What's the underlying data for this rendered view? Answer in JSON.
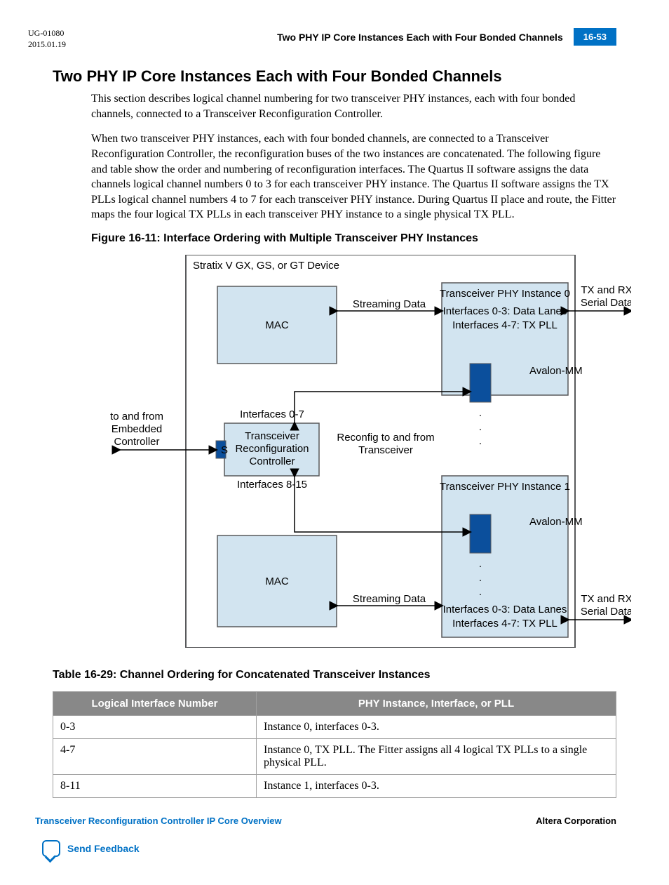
{
  "header": {
    "doc_id": "UG-01080",
    "date": "2015.01.19",
    "running_title": "Two PHY IP Core Instances Each with Four Bonded Channels",
    "page_num": "16-53"
  },
  "section_title": "Two PHY IP Core Instances Each with Four Bonded Channels",
  "para1": "This section describes logical channel numbering for two transceiver PHY instances, each with four bonded channels, connected to a Transceiver Reconfiguration Controller.",
  "para2": "When two transceiver PHY instances, each with four bonded channels, are connected to a Transceiver Reconfiguration Controller, the reconfiguration buses of the two instances are concatenated. The following figure and table show the order and numbering of reconfiguration interfaces. The Quartus II software assigns the data channels logical channel numbers 0 to 3 for each transceiver PHY instance. The Quartus II software assigns the TX PLLs logical channel numbers 4 to 7 for each transceiver PHY instance. During Quartus II place and route, the Fitter maps the four logical TX PLLs in each transceiver PHY instance to a single physical TX PLL.",
  "figure_caption": "Figure 16-11: Interface Ordering with Multiple Transceiver PHY Instances",
  "diagram": {
    "device_label": "Stratix V GX, GS, or GT Device",
    "mac": "MAC",
    "streaming_data": "Streaming Data",
    "phy0_title": "Transceiver PHY Instance 0",
    "phy0_line1": "Interfaces 0-3: Data Lanes",
    "phy0_line2": "Interfaces 4-7: TX PLL",
    "phy1_title": "Transceiver PHY Instance 1",
    "phy1_line1": "Interfaces 0-3: Data Lanes",
    "phy1_line2": "Interfaces 4-7: TX PLL",
    "avalon": "Avalon-MM",
    "reconfig_block_l1": "Transceiver",
    "reconfig_block_l2": "Reconfiguration",
    "reconfig_block_l3": "Controller",
    "reconfig_top": "Interfaces 0-7",
    "reconfig_bot": "Interfaces 8-15",
    "reconfig_label_l1": "Reconfig to and from",
    "reconfig_label_l2": "Transceiver",
    "s_label": "S",
    "embedded_l1": "to and from",
    "embedded_l2": "Embedded",
    "embedded_l3": "Controller",
    "serial_l1": "TX and RX",
    "serial_l2": "Serial Data"
  },
  "table_caption": "Table 16-29: Channel Ordering for Concatenated Transceiver Instances",
  "table": {
    "h1": "Logical Interface Number",
    "h2": "PHY Instance, Interface, or PLL",
    "rows": [
      {
        "c1": "0-3",
        "c2": "Instance 0, interfaces 0-3."
      },
      {
        "c1": "4-7",
        "c2": "Instance 0, TX PLL. The Fitter assigns all 4 logical TX PLLs to a single physical PLL."
      },
      {
        "c1": "8-11",
        "c2": "Instance 1, interfaces 0-3."
      }
    ]
  },
  "footer": {
    "left": "Transceiver Reconfiguration Controller IP Core Overview",
    "right": "Altera Corporation",
    "feedback": "Send Feedback"
  },
  "chart_data": {
    "type": "diagram",
    "description": "Block diagram showing two MAC blocks connected via Streaming Data to two Transceiver PHY Instances (0 and 1) inside a Stratix V device. A Transceiver Reconfiguration Controller connects via Avalon-MM slave (S) to an embedded controller on the left, and via reconfig buses (Interfaces 0-7 and 8-15) to the two PHY instances. Each PHY instance outputs TX and RX Serial Data.",
    "blocks": [
      {
        "name": "MAC",
        "instance": 0
      },
      {
        "name": "MAC",
        "instance": 1
      },
      {
        "name": "Transceiver Reconfiguration Controller",
        "slave_port": "S",
        "interfaces": [
          "0-7",
          "8-15"
        ]
      },
      {
        "name": "Transceiver PHY Instance 0",
        "data_lanes": "Interfaces 0-3",
        "tx_pll": "Interfaces 4-7"
      },
      {
        "name": "Transceiver PHY Instance 1",
        "data_lanes": "Interfaces 0-3",
        "tx_pll": "Interfaces 4-7"
      }
    ],
    "connections": [
      {
        "from": "Embedded Controller",
        "to": "Reconfiguration Controller.S",
        "bus": "Avalon-MM",
        "dir": "bidir"
      },
      {
        "from": "MAC 0",
        "to": "PHY Instance 0",
        "bus": "Streaming Data",
        "dir": "bidir"
      },
      {
        "from": "MAC 1",
        "to": "PHY Instance 1",
        "bus": "Streaming Data",
        "dir": "bidir"
      },
      {
        "from": "Reconfiguration Controller",
        "to": "PHY Instance 0 Avalon-MM",
        "bus": "Interfaces 0-7",
        "dir": "bidir"
      },
      {
        "from": "Reconfiguration Controller",
        "to": "PHY Instance 1 Avalon-MM",
        "bus": "Interfaces 8-15",
        "dir": "bidir"
      },
      {
        "from": "PHY Instance 0",
        "to": "external",
        "bus": "TX and RX Serial Data",
        "dir": "bidir"
      },
      {
        "from": "PHY Instance 1",
        "to": "external",
        "bus": "TX and RX Serial Data",
        "dir": "bidir"
      }
    ]
  }
}
